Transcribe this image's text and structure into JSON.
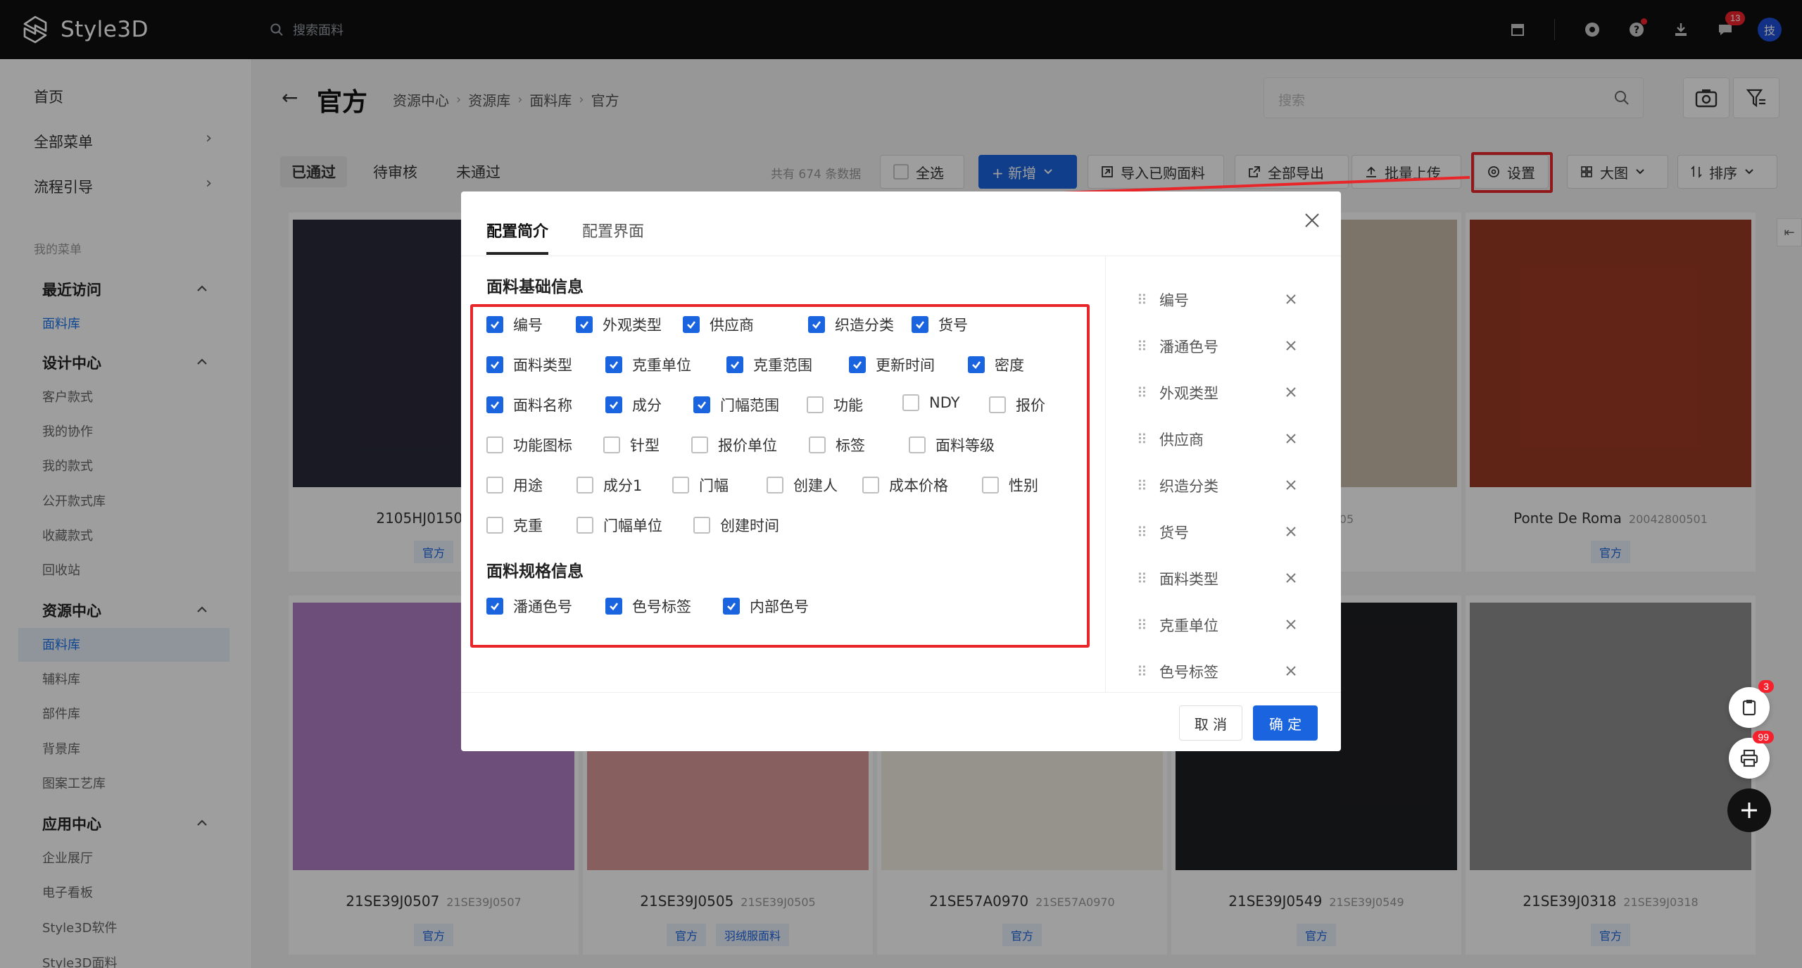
{
  "app": {
    "name": "Style3D"
  },
  "topbar": {
    "search_placeholder": "搜索面料",
    "message_badge": "13"
  },
  "sidebar": {
    "top": [
      {
        "label": "首页"
      },
      {
        "label": "全部菜单"
      },
      {
        "label": "流程引导"
      }
    ],
    "my_menu_caption": "我的菜单",
    "groups": [
      {
        "label": "最近访问",
        "items": [
          "面料库"
        ]
      },
      {
        "label": "设计中心",
        "items": [
          "客户款式",
          "我的协作",
          "我的款式",
          "公开款式库",
          "收藏款式",
          "回收站"
        ]
      },
      {
        "label": "资源中心",
        "items": [
          "面料库",
          "辅料库",
          "部件库",
          "背景库",
          "图案工艺库"
        ]
      },
      {
        "label": "应用中心",
        "items": [
          "企业展厅",
          "电子看板",
          "Style3D软件",
          "Style3D面料"
        ]
      }
    ]
  },
  "header": {
    "title": "官方",
    "breadcrumb": [
      "资源中心",
      "资源库",
      "面料库",
      "官方"
    ],
    "search_placeholder": "搜索"
  },
  "toolbar": {
    "tabs": [
      "已通过",
      "待审核",
      "未通过"
    ],
    "total": "共有 674 条数据",
    "select_all": "全选",
    "add": "+ 新增",
    "import": "导入已购面料",
    "export_all": "全部导出",
    "batch_upload": "批量上传",
    "settings": "设置",
    "view": "大图",
    "sort": "排序"
  },
  "cards": [
    {
      "code": "2105HJ0150",
      "sub": "210",
      "tags": [
        "官方"
      ],
      "color": "#2b2a3a"
    },
    {
      "code": "",
      "sub": "",
      "tags": [],
      "color": "#d9d3c6"
    },
    {
      "code": "",
      "sub": "",
      "tags": [],
      "color": "#e0ddd6"
    },
    {
      "code": "",
      "sub": "1SE39J0405",
      "tags": [],
      "color": "#c8bca8"
    },
    {
      "code": "Ponte De Roma",
      "sub": "20042800501",
      "tags": [
        "官方"
      ],
      "color": "#9c3a25"
    },
    {
      "code": "21SE39J0507",
      "sub": "21SE39J0507",
      "tags": [
        "官方"
      ],
      "color": "#b07cc4"
    },
    {
      "code": "21SE39J0505",
      "sub": "21SE39J0505",
      "tags": [
        "官方",
        "羽绒服面料"
      ],
      "color": "#d99a98"
    },
    {
      "code": "21SE57A0970",
      "sub": "21SE57A0970",
      "tags": [
        "官方"
      ],
      "color": "#f2ede4"
    },
    {
      "code": "21SE39J0549",
      "sub": "21SE39J0549",
      "tags": [
        "官方"
      ],
      "color": "#1e1f22"
    },
    {
      "code": "21SE39J0318",
      "sub": "21SE39J0318",
      "tags": [
        "官方"
      ],
      "color": "#8e8e8e"
    }
  ],
  "modal": {
    "tabs": [
      "配置简介",
      "配置界面"
    ],
    "section_basic": "面料基础信息",
    "section_spec": "面料规格信息",
    "basic_rows": [
      [
        {
          "label": "编号",
          "checked": true
        },
        {
          "label": "外观类型",
          "checked": true
        },
        {
          "label": "供应商",
          "checked": true
        },
        {
          "label": "织造分类",
          "checked": true
        },
        {
          "label": "货号",
          "checked": true
        }
      ],
      [
        {
          "label": "面料类型",
          "checked": true
        },
        {
          "label": "克重单位",
          "checked": true
        },
        {
          "label": "克重范围",
          "checked": true
        },
        {
          "label": "更新时间",
          "checked": true
        },
        {
          "label": "密度",
          "checked": true
        }
      ],
      [
        {
          "label": "面料名称",
          "checked": true
        },
        {
          "label": "成分",
          "checked": true
        },
        {
          "label": "门幅范围",
          "checked": true
        },
        {
          "label": "功能",
          "checked": false
        },
        {
          "label": "NDY",
          "checked": false
        },
        {
          "label": "报价",
          "checked": false
        }
      ],
      [
        {
          "label": "功能图标",
          "checked": false
        },
        {
          "label": "针型",
          "checked": false
        },
        {
          "label": "报价单位",
          "checked": false
        },
        {
          "label": "标签",
          "checked": false
        },
        {
          "label": "面料等级",
          "checked": false
        }
      ],
      [
        {
          "label": "用途",
          "checked": false
        },
        {
          "label": "成分1",
          "checked": false
        },
        {
          "label": "门幅",
          "checked": false
        },
        {
          "label": "创建人",
          "checked": false
        },
        {
          "label": "成本价格",
          "checked": false
        },
        {
          "label": "性别",
          "checked": false
        }
      ],
      [
        {
          "label": "克重",
          "checked": false
        },
        {
          "label": "门幅单位",
          "checked": false
        },
        {
          "label": "创建时间",
          "checked": false
        }
      ]
    ],
    "spec_row": [
      {
        "label": "潘通色号",
        "checked": true
      },
      {
        "label": "色号标签",
        "checked": true
      },
      {
        "label": "内部色号",
        "checked": true
      }
    ],
    "selected": [
      "编号",
      "潘通色号",
      "外观类型",
      "供应商",
      "织造分类",
      "货号",
      "面料类型",
      "克重单位",
      "色号标签"
    ],
    "cancel": "取 消",
    "ok": "确 定"
  },
  "floating": {
    "cart_badge": "3",
    "print_badge": "99"
  }
}
